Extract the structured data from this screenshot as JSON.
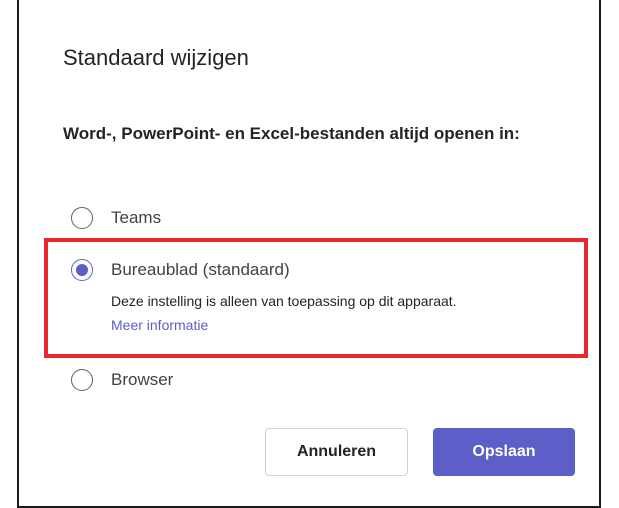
{
  "dialog": {
    "title": "Standaard wijzigen",
    "question": "Word-, PowerPoint- en Excel-bestanden altijd openen in:",
    "options": [
      {
        "label": "Teams",
        "checked": false
      },
      {
        "label": "Bureaublad (standaard)",
        "checked": true,
        "description": "Deze instelling is alleen van toepassing op dit apparaat.",
        "link": "Meer informatie"
      },
      {
        "label": "Browser",
        "checked": false
      }
    ],
    "buttons": {
      "cancel": "Annuleren",
      "save": "Opslaan"
    }
  },
  "colors": {
    "accent": "#5b5fc7",
    "highlight": "#e8262e"
  }
}
